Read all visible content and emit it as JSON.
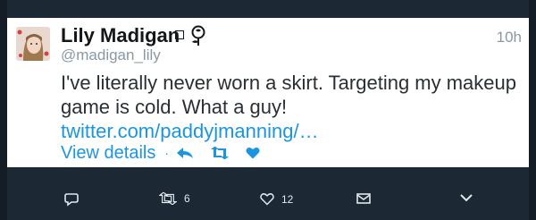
{
  "tweet": {
    "display_name": "Lily Madigan",
    "handle": "@madigan_lily",
    "time": "10h",
    "text_prefix": "I've literally never worn a skirt. Targeting my makeup game is cold. What a guy! ",
    "link_text": "twitter.com/paddyjmanning/…",
    "view_details": "View details",
    "separator": "·"
  },
  "actions": {
    "icons": [
      "reply-icon",
      "retweet-icon",
      "like-icon"
    ]
  },
  "bottom_bar": {
    "reply_icon": "comment-icon",
    "retweet_count": "6",
    "like_count": "12",
    "dm_icon": "envelope-icon",
    "more_icon": "chevron-down-icon"
  },
  "colors": {
    "background": "#1c2833",
    "card": "#ffffff",
    "link": "#1b95e0",
    "muted": "#8899a6"
  }
}
